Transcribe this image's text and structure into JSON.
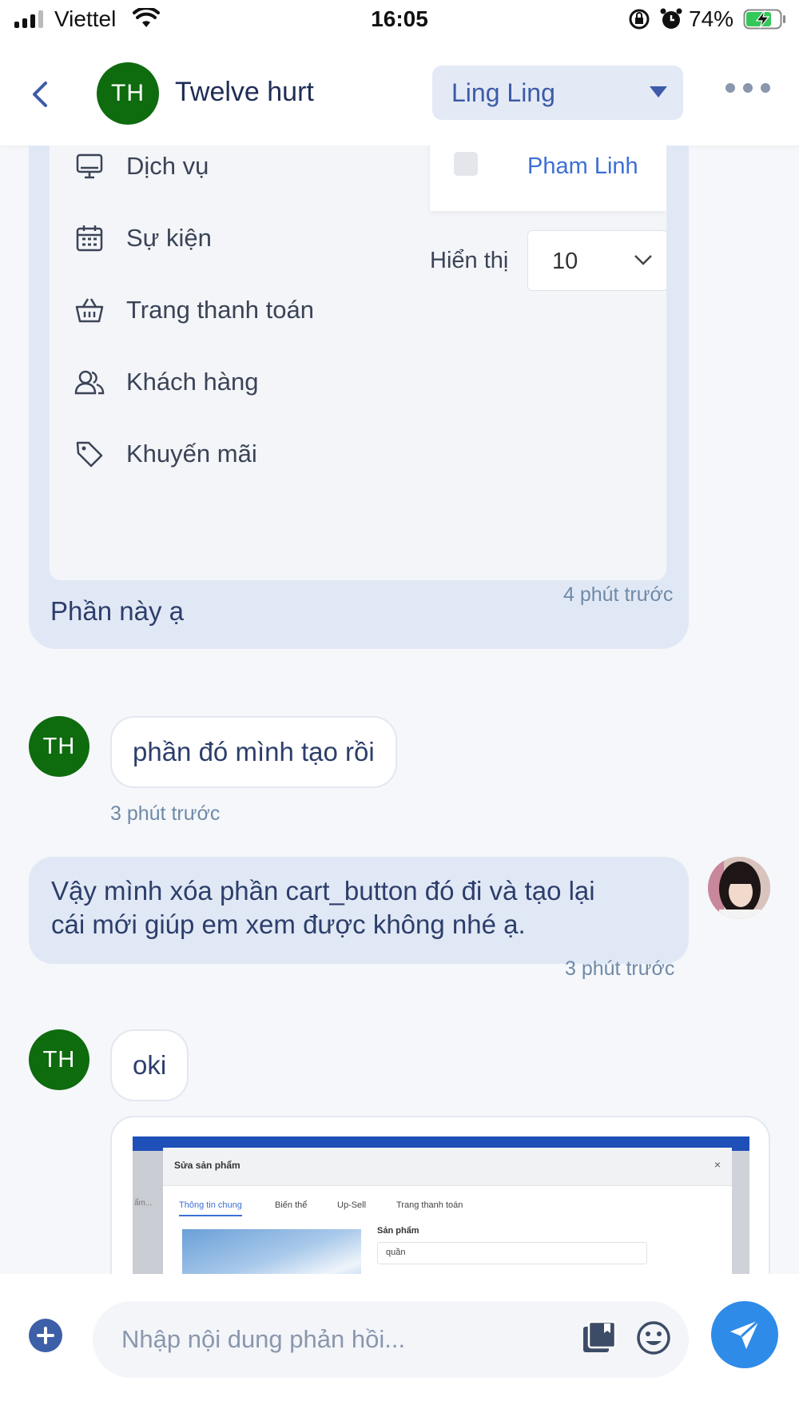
{
  "status_bar": {
    "carrier": "Viettel",
    "time": "16:05",
    "battery_percent": "74%",
    "icons": [
      "signal-icon",
      "wifi-icon",
      "rotation-lock-icon",
      "alarm-icon",
      "battery-charging-icon"
    ]
  },
  "header": {
    "back_icon": "chevron-left-icon",
    "contact_initials": "TH",
    "contact_name": "Twelve hurt",
    "assignee": "Ling Ling",
    "more_icon": "more-dots-icon"
  },
  "messages": {
    "m1": {
      "screenshot": {
        "menu": [
          "Dịch vụ",
          "Sự kiện",
          "Trang thanh toán",
          "Khách hàng",
          "Khuyến mãi"
        ],
        "dropdown_option": "Pham Linh",
        "show_label": "Hiển thị",
        "show_value": "10"
      },
      "caption": "Phần này ạ",
      "time": "4 phút trước"
    },
    "m2": {
      "initials": "TH",
      "text": "phần đó mình tạo rồi",
      "time": "3 phút trước"
    },
    "m3": {
      "line1": "Vậy mình xóa phần cart_button đó đi và tạo lại",
      "line2": "cái mới giúp em xem được không nhé ạ.",
      "time": "3 phút trước"
    },
    "m4": {
      "initials": "TH",
      "text": "oki",
      "attachment": {
        "dialog_title": "Sửa sản phẩm",
        "close": "×",
        "tabs": [
          "Thông tin chung",
          "Biến thể",
          "Up-Sell",
          "Trang thanh toán"
        ],
        "field_label": "Sản phẩm",
        "field_value": "quần",
        "side_text": "ẩm..."
      }
    }
  },
  "composer": {
    "placeholder": "Nhập nội dung phản hồi...",
    "icons": [
      "plus-icon",
      "library-icon",
      "emoji-icon",
      "send-icon"
    ]
  },
  "colors": {
    "accent": "#2f8be8",
    "avatar_green": "#0e6b0e",
    "outgoing_bubble": "#e1e8f5",
    "link_blue": "#3d6fd6"
  }
}
